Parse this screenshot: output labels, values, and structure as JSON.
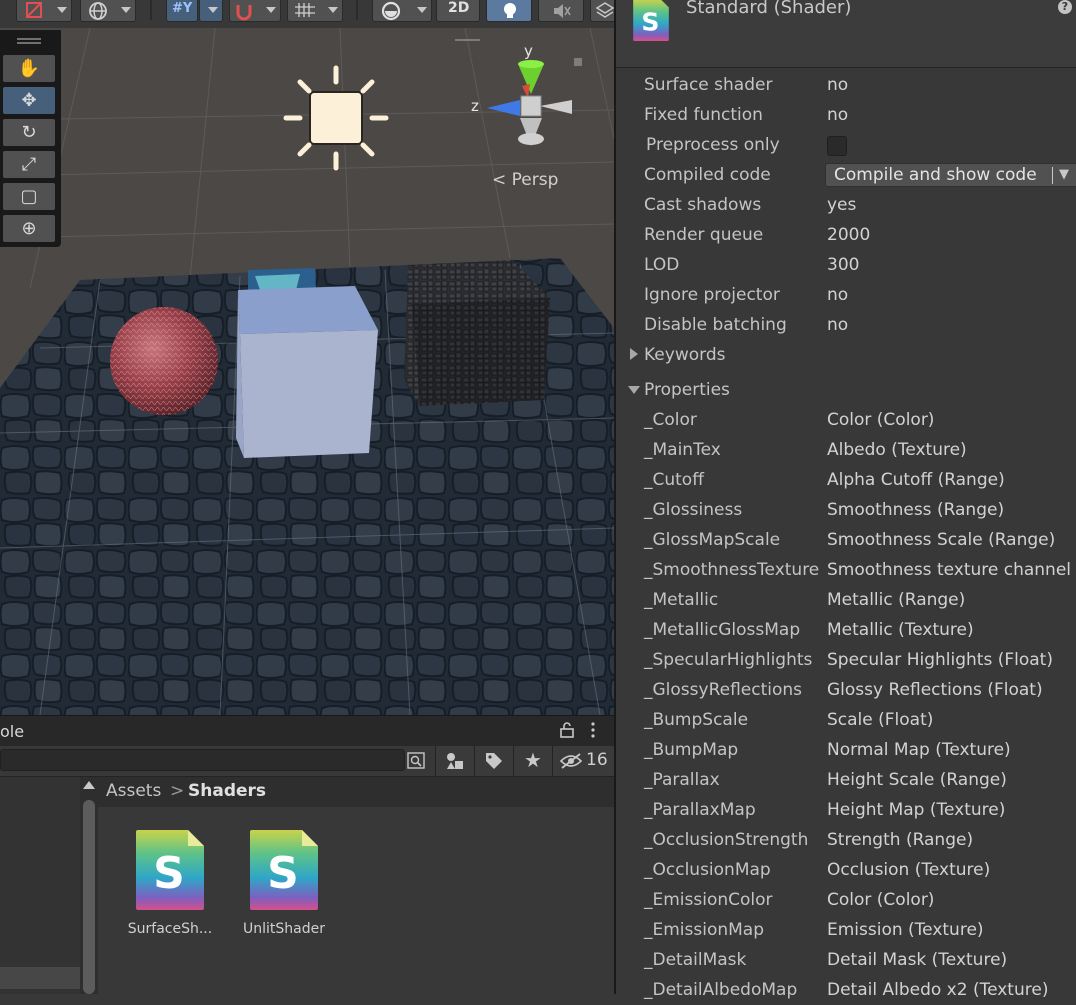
{
  "toolbar": {
    "mode_2d_label": "2D",
    "axis_label": "#Y",
    "items": [
      "gizmo-tool",
      "global-toggle",
      "grid-snap",
      "snap-increment",
      "grid-visibility",
      "render-mode",
      "2d-toggle",
      "lighting-toggle",
      "audio-toggle",
      "effects-toggle"
    ]
  },
  "tool_palette": {
    "tools": [
      {
        "name": "hand-tool",
        "glyph": "✋"
      },
      {
        "name": "move-tool",
        "glyph": "✥"
      },
      {
        "name": "rotate-tool",
        "glyph": "↻"
      },
      {
        "name": "scale-tool",
        "glyph": "⤢"
      },
      {
        "name": "rect-tool",
        "glyph": "▢"
      },
      {
        "name": "transform-tool",
        "glyph": "⊕"
      }
    ],
    "active_index": 1
  },
  "scene": {
    "gizmo_y_label": "y",
    "gizmo_z_label": "z",
    "projection_label": "< Persp"
  },
  "project_panel": {
    "tab_label": "ole",
    "hidden_count": "16",
    "breadcrumb": {
      "root": "Assets",
      "separator": ">",
      "current": "Shaders"
    },
    "assets": [
      {
        "name": "SurfaceSh...",
        "icon": "shader-icon"
      },
      {
        "name": "UnlitShader",
        "icon": "shader-icon"
      }
    ]
  },
  "inspector": {
    "title": "Standard (Shader)",
    "help": "?",
    "info_rows": [
      {
        "key": "Surface shader",
        "value": "no"
      },
      {
        "key": "Fixed function",
        "value": "no"
      },
      {
        "key": "Preprocess only",
        "value": "",
        "type": "checkbox",
        "checked": false
      },
      {
        "key": "Compiled code",
        "value": "Compile and show code",
        "type": "dropdown"
      },
      {
        "key": "Cast shadows",
        "value": "yes"
      },
      {
        "key": "Render queue",
        "value": "2000"
      },
      {
        "key": "LOD",
        "value": "300"
      },
      {
        "key": "Ignore projector",
        "value": "no"
      },
      {
        "key": "Disable batching",
        "value": "no"
      }
    ],
    "keywords_label": "Keywords",
    "keywords_expanded": false,
    "properties_label": "Properties",
    "properties_expanded": true,
    "properties": [
      {
        "key": "_Color",
        "value": "Color (Color)"
      },
      {
        "key": "_MainTex",
        "value": "Albedo (Texture)"
      },
      {
        "key": "_Cutoff",
        "value": "Alpha Cutoff (Range)"
      },
      {
        "key": "_Glossiness",
        "value": "Smoothness (Range)"
      },
      {
        "key": "_GlossMapScale",
        "value": "Smoothness Scale (Range)"
      },
      {
        "key": "_SmoothnessTexture",
        "value": "Smoothness texture channel"
      },
      {
        "key": "_Metallic",
        "value": "Metallic (Range)"
      },
      {
        "key": "_MetallicGlossMap",
        "value": "Metallic (Texture)"
      },
      {
        "key": "_SpecularHighlights",
        "value": "Specular Highlights (Float)"
      },
      {
        "key": "_GlossyReflections",
        "value": "Glossy Reflections (Float)"
      },
      {
        "key": "_BumpScale",
        "value": "Scale (Float)"
      },
      {
        "key": "_BumpMap",
        "value": "Normal Map (Texture)"
      },
      {
        "key": "_Parallax",
        "value": "Height Scale (Range)"
      },
      {
        "key": "_ParallaxMap",
        "value": "Height Map (Texture)"
      },
      {
        "key": "_OcclusionStrength",
        "value": "Strength (Range)"
      },
      {
        "key": "_OcclusionMap",
        "value": "Occlusion (Texture)"
      },
      {
        "key": "_EmissionColor",
        "value": "Color (Color)"
      },
      {
        "key": "_EmissionMap",
        "value": "Emission (Texture)"
      },
      {
        "key": "_DetailMask",
        "value": "Detail Mask (Texture)"
      },
      {
        "key": "_DetailAlbedoMap",
        "value": "Detail Albedo x2 (Texture)"
      }
    ]
  },
  "colors": {
    "active_tool": "#46607c",
    "panel_bg": "#383838",
    "text": "#c4c4c4"
  }
}
